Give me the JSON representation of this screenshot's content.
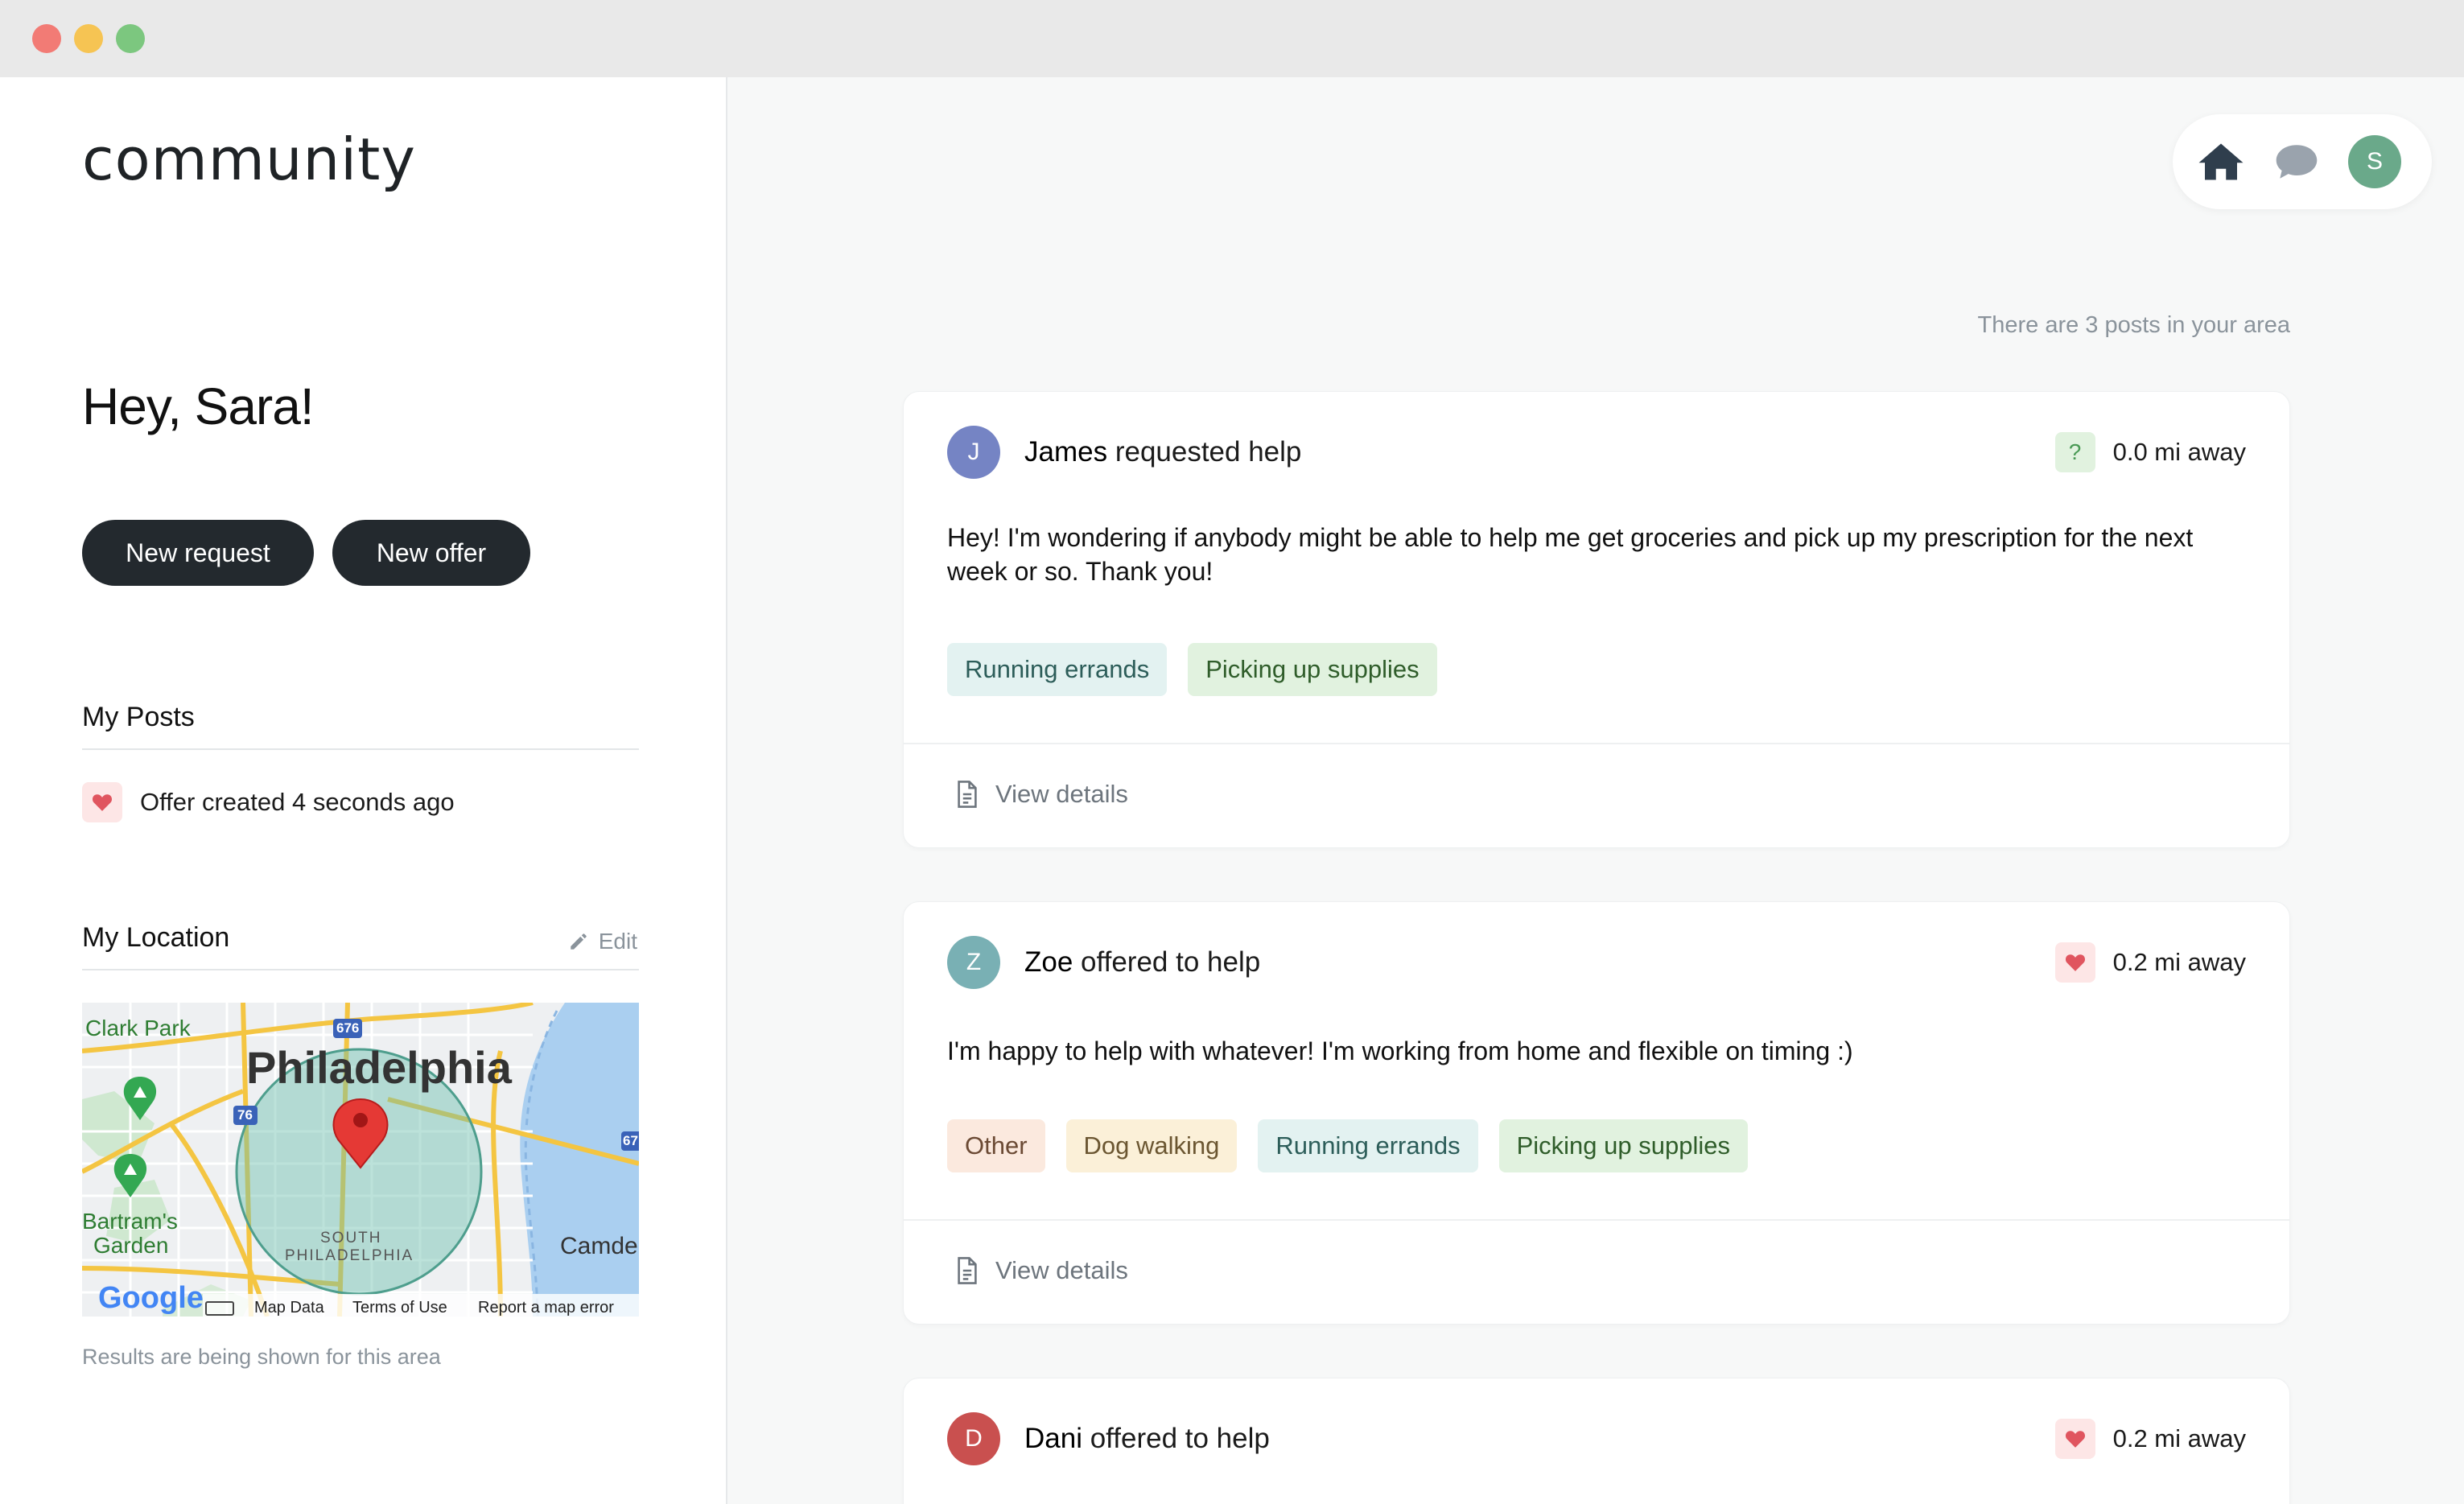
{
  "app": {
    "logo": "community",
    "greeting": "Hey, Sara!"
  },
  "sidebar": {
    "new_request_label": "New request",
    "new_offer_label": "New offer",
    "my_posts_title": "My Posts",
    "my_posts_items": [
      {
        "icon": "heart-icon",
        "text": "Offer created 4 seconds ago"
      }
    ],
    "my_location_title": "My Location",
    "edit_label": "Edit",
    "map": {
      "labels": {
        "city": "Philadelphia",
        "park": "Clark Park",
        "garden_1": "Bartram's",
        "garden_2": "Garden",
        "district_1": "SOUTH",
        "district_2": "PHILADELPHIA",
        "camden": "Camde",
        "hwy_676": "676",
        "hwy_76": "76",
        "hwy_67": "67",
        "google": "Google",
        "map_data": "Map Data",
        "terms": "Terms of Use",
        "report": "Report a map error"
      }
    },
    "map_caption": "Results are being shown for this area"
  },
  "nav": {
    "home_icon": "home-icon",
    "messages_icon": "chat-bubble-icon",
    "avatar_initial": "S"
  },
  "feed": {
    "count_text": "There are 3 posts in your area",
    "view_details_label": "View details",
    "posts": [
      {
        "initial": "J",
        "name": "James",
        "action": " requested help",
        "badge": "?",
        "distance": "0.0 mi away",
        "body": "Hey! I'm wondering if anybody might be able to help me get groceries and pick up my prescription for the next week or so. Thank you!",
        "tags": [
          "Running errands",
          "Picking up supplies"
        ]
      },
      {
        "initial": "Z",
        "name": "Zoe",
        "action": " offered to help",
        "distance": "0.2 mi away",
        "body": "I'm happy to help with whatever! I'm working from home and flexible on timing :)",
        "tags": [
          "Other",
          "Dog walking",
          "Running errands",
          "Picking up supplies"
        ]
      },
      {
        "initial": "D",
        "name": "Dani",
        "action": " offered to help",
        "distance": "0.2 mi away"
      }
    ]
  },
  "colors": {
    "dark_button": "#23292e",
    "avatar_james": "#7584c4",
    "avatar_zoe": "#79b0b4",
    "avatar_dani": "#c9504f",
    "avatar_sara": "#6aa98a",
    "heart": "#e0555f"
  }
}
